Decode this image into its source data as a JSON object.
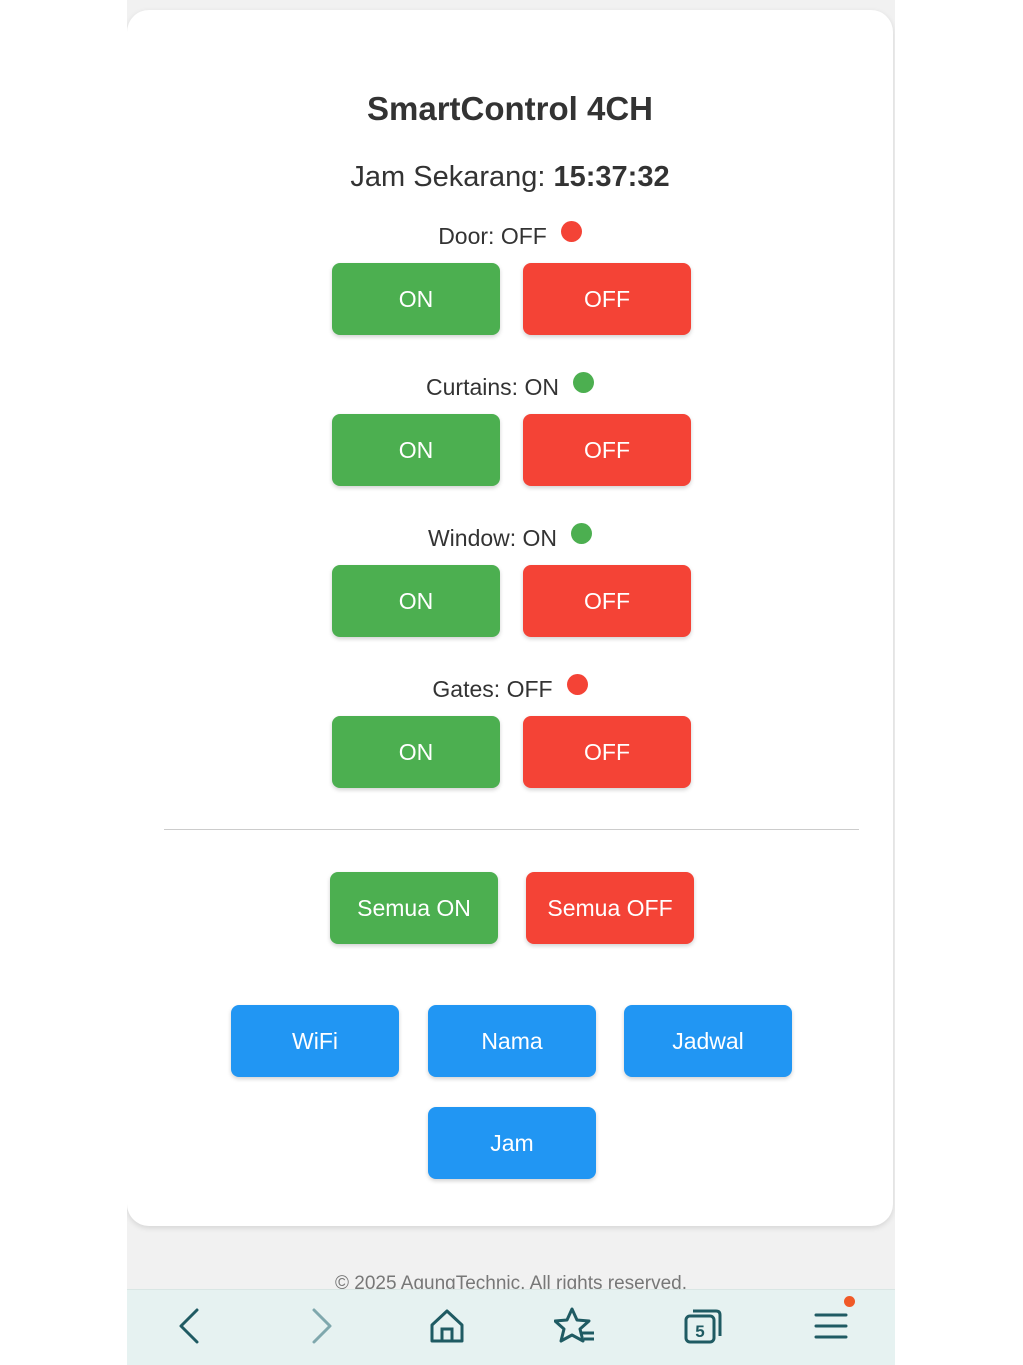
{
  "app": {
    "title": "SmartControl 4CH"
  },
  "clock": {
    "label": "Jam Sekarang:",
    "time": "15:37:32"
  },
  "devices": [
    {
      "label": "Door: OFF",
      "state": "off",
      "on_label": "ON",
      "off_label": "OFF"
    },
    {
      "label": "Curtains: ON",
      "state": "on",
      "on_label": "ON",
      "off_label": "OFF"
    },
    {
      "label": "Window: ON",
      "state": "on",
      "on_label": "ON",
      "off_label": "OFF"
    },
    {
      "label": "Gates: OFF",
      "state": "off",
      "on_label": "ON",
      "off_label": "OFF"
    }
  ],
  "all_controls": {
    "all_on_label": "Semua ON",
    "all_off_label": "Semua OFF"
  },
  "settings": {
    "wifi_label": "WiFi",
    "name_label": "Nama",
    "schedule_label": "Jadwal",
    "clock_label": "Jam"
  },
  "footer": {
    "text": "© 2025 AgungTechnic. All rights reserved."
  },
  "browser_nav": {
    "tab_count": "5"
  },
  "colors": {
    "on": "#4caf50",
    "off": "#f44336",
    "blue": "#2196f3",
    "nav_icon": "#1f5b63",
    "notif": "#f05a28"
  }
}
